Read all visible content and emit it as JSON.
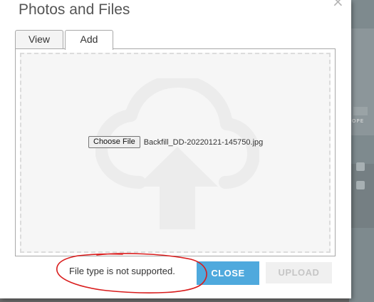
{
  "dialog": {
    "title": "Photos and Files",
    "close_glyph": "×"
  },
  "tabs": [
    {
      "label": "View",
      "active": false
    },
    {
      "label": "Add",
      "active": true
    }
  ],
  "upload": {
    "choose_button_label": "Choose File",
    "selected_file": "Backfill_DD-20220121-145750.jpg",
    "dropzone_icon": "cloud-upload-icon"
  },
  "status": {
    "message": "File type is not supported."
  },
  "buttons": {
    "close_label": "CLOSE",
    "upload_label": "UPLOAD",
    "upload_enabled": false
  },
  "background": {
    "map_label": "OPE"
  },
  "colors": {
    "primary": "#4fa9dd",
    "annotation": "#d91c1c",
    "disabled": "#f0f0f0"
  }
}
